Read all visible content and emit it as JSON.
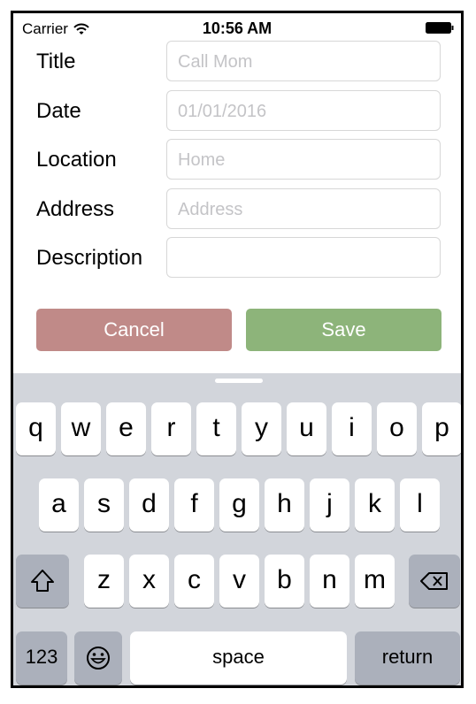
{
  "status_bar": {
    "carrier": "Carrier",
    "time": "10:56 AM"
  },
  "form": {
    "fields": [
      {
        "label": "Title",
        "placeholder": "Call Mom"
      },
      {
        "label": "Date",
        "placeholder": "01/01/2016"
      },
      {
        "label": "Location",
        "placeholder": "Home"
      },
      {
        "label": "Address",
        "placeholder": "Address"
      },
      {
        "label": "Description",
        "placeholder": ""
      }
    ]
  },
  "buttons": {
    "cancel": "Cancel",
    "save": "Save"
  },
  "colors": {
    "cancel": "#c08a88",
    "save": "#8db47a",
    "keyboard_bg": "#d2d5db"
  },
  "keyboard": {
    "row1": [
      "q",
      "w",
      "e",
      "r",
      "t",
      "y",
      "u",
      "i",
      "o",
      "p"
    ],
    "row2": [
      "a",
      "s",
      "d",
      "f",
      "g",
      "h",
      "j",
      "k",
      "l"
    ],
    "row3": [
      "z",
      "x",
      "c",
      "v",
      "b",
      "n",
      "m"
    ],
    "numbers_label": "123",
    "space_label": "space",
    "return_label": "return",
    "icons": {
      "shift": "shift-icon",
      "delete": "delete-icon",
      "emoji": "emoji-icon"
    }
  }
}
